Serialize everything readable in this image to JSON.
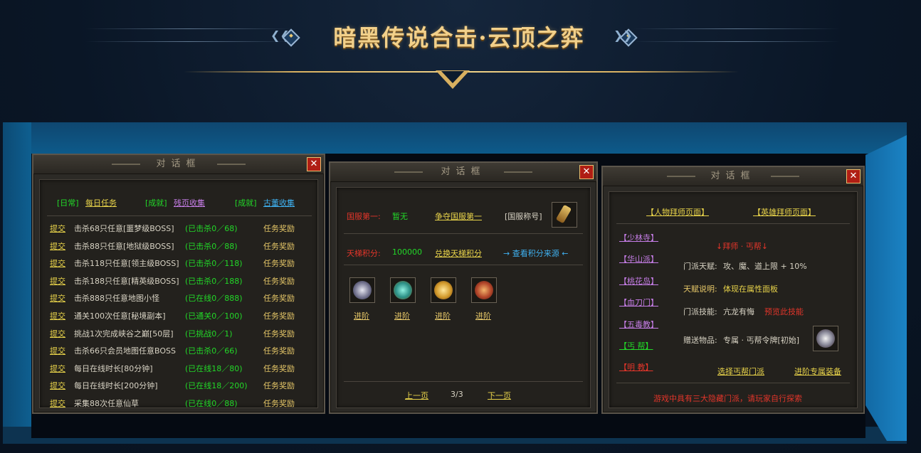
{
  "banner": {
    "title": "暗黑传说合击·云顶之弈"
  },
  "panels": [
    {
      "title": "对话框",
      "tabs": [
        {
          "prefix": "[日常]",
          "label": "每日任务"
        },
        {
          "prefix": "[成就]",
          "label": "残页收集"
        },
        {
          "prefix": "[成就]",
          "label": "古董收集"
        }
      ],
      "tasks": [
        {
          "action": "提交",
          "name": "击杀68只任意[噩梦级BOSS]",
          "progress": "(已击杀0／68)",
          "reward": "任务奖励"
        },
        {
          "action": "提交",
          "name": "击杀88只任意[地狱级BOSS]",
          "progress": "(已击杀0／88)",
          "reward": "任务奖励"
        },
        {
          "action": "提交",
          "name": "击杀118只任意[领主级BOSS]",
          "progress": "(已击杀0／118)",
          "reward": "任务奖励"
        },
        {
          "action": "提交",
          "name": "击杀188只任意[精英级BOSS]",
          "progress": "(已击杀0／188)",
          "reward": "任务奖励"
        },
        {
          "action": "提交",
          "name": "击杀888只任意地图小怪",
          "progress": "(已在线0／888)",
          "reward": "任务奖励"
        },
        {
          "action": "提交",
          "name": "通关100次任意[秘境副本]",
          "progress": "(已通关0／100)",
          "reward": "任务奖励"
        },
        {
          "action": "提交",
          "name": "挑战1次完成峡谷之巅[50层]",
          "progress": "(已挑战0／1)",
          "reward": "任务奖励"
        },
        {
          "action": "提交",
          "name": "击杀66只会员地图任意BOSS",
          "progress": "(已击杀0／66)",
          "reward": "任务奖励"
        },
        {
          "action": "提交",
          "name": "每日在线时长[80分钟]",
          "progress": "(已在线18／80)",
          "reward": "任务奖励"
        },
        {
          "action": "提交",
          "name": "每日在线时长[200分钟]",
          "progress": "(已在线18／200)",
          "reward": "任务奖励"
        },
        {
          "action": "提交",
          "name": "采集88次任意仙草",
          "progress": "(已在线0／88)",
          "reward": "任务奖励"
        }
      ]
    },
    {
      "title": "对话框",
      "first_label": "国服第一:",
      "first_value": "暂无",
      "first_link": "争夺国服第一",
      "title_label": "[国服称号]",
      "ladder_label": "天梯积分:",
      "ladder_value": "100000",
      "ladder_link": "兑换天梯积分",
      "source_link": "→ 查看积分来源 ←",
      "advances": [
        "进阶",
        "进阶",
        "进阶",
        "进阶"
      ],
      "prev": "上一页",
      "page": "3/3",
      "next": "下一页"
    },
    {
      "title": "对话框",
      "top_links": [
        "【人物拜师页面】",
        "【英雄拜师页面】"
      ],
      "sects": [
        {
          "label": "【少林寺】",
          "color": "#c77ee8"
        },
        {
          "label": "【华山派】",
          "color": "#c77ee8"
        },
        {
          "label": "【桃花岛】",
          "color": "#c77ee8"
        },
        {
          "label": "【血刀门】",
          "color": "#c77ee8"
        },
        {
          "label": "【五毒教】",
          "color": "#c77ee8"
        },
        {
          "label": "【丐  帮】",
          "color": "#22d828"
        },
        {
          "label": "【明  教】",
          "color": "#e2352a"
        }
      ],
      "heading": "↓拜师 · 丐帮↓",
      "talent_label": "门派天赋:",
      "talent_value": "攻、魔、道上限 + 10%",
      "talent_desc_label": "天赋说明:",
      "talent_desc_value": "体现在属性面板",
      "skill_label": "门派技能:",
      "skill_value": "亢龙有悔",
      "skill_preview": "预览此技能",
      "gift_label": "赠送物品:",
      "gift_value": "专属 · 丐帮令牌[初始]",
      "choose_link": "选择丐帮门派",
      "equip_link": "进阶专属装备",
      "footer": "游戏中具有三大隐藏门派，请玩家自行探索"
    }
  ]
}
